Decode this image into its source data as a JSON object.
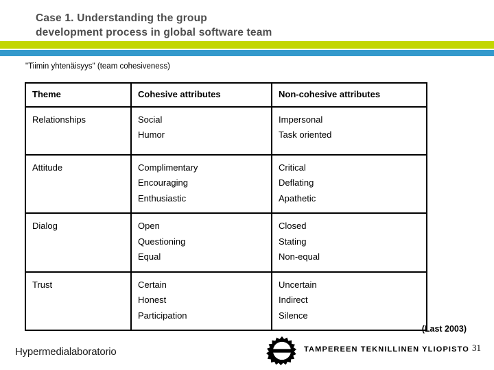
{
  "slide": {
    "title": "Case 1. Understanding the group\ndevelopment process in global software team",
    "subtitle": "\"Tiimin yhtenäisyys\" (team cohesiveness)",
    "accent_green": "#c3d600",
    "accent_blue": "#3399cc"
  },
  "table": {
    "headers": [
      "Theme",
      "Cohesive attributes",
      "Non-cohesive attributes"
    ],
    "rows": [
      {
        "theme": "Relationships",
        "cohesive": [
          "Social",
          "Humor"
        ],
        "non_cohesive": [
          "Impersonal",
          "Task oriented"
        ]
      },
      {
        "theme": "Attitude",
        "cohesive": [
          "Complimentary",
          "Encouraging",
          "Enthusiastic"
        ],
        "non_cohesive": [
          "Critical",
          "Deflating",
          "Apathetic"
        ]
      },
      {
        "theme": "Dialog",
        "cohesive": [
          "Open",
          "Questioning",
          "Equal"
        ],
        "non_cohesive": [
          "Closed",
          "Stating",
          "Non-equal"
        ]
      },
      {
        "theme": "Trust",
        "cohesive": [
          "Certain",
          "Honest",
          "Participation"
        ],
        "non_cohesive": [
          "Uncertain",
          "Indirect",
          "Silence"
        ]
      }
    ]
  },
  "footer": {
    "source_note": "(Last 2003)",
    "lab_name": "Hypermedialaboratorio",
    "university_name": "TAMPEREEN TEKNILLINEN YLIOPISTO",
    "page_number": "31"
  }
}
